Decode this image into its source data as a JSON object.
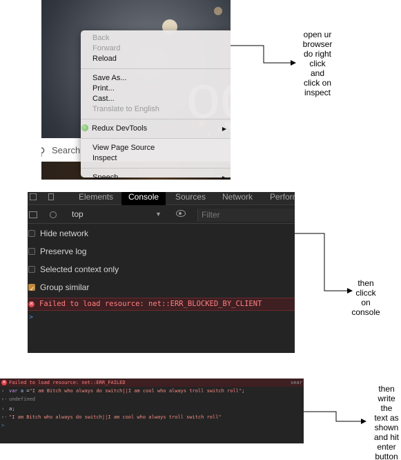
{
  "panel1": {
    "bg_text": "og",
    "search_label": "Search",
    "context_menu": {
      "groups": [
        [
          {
            "label": "Back",
            "disabled": true
          },
          {
            "label": "Forward",
            "disabled": true
          },
          {
            "label": "Reload",
            "disabled": false
          }
        ],
        [
          {
            "label": "Save As...",
            "disabled": false
          },
          {
            "label": "Print...",
            "disabled": false
          },
          {
            "label": "Cast...",
            "disabled": false
          },
          {
            "label": "Translate to English",
            "disabled": true
          }
        ],
        [
          {
            "label": "Redux DevTools",
            "disabled": false,
            "submenu": true
          }
        ],
        [
          {
            "label": "View Page Source",
            "disabled": false
          },
          {
            "label": "Inspect",
            "disabled": false
          }
        ],
        [
          {
            "label": "Speech",
            "disabled": false,
            "submenu": true
          }
        ]
      ]
    }
  },
  "panel2": {
    "tabs": [
      "Elements",
      "Console",
      "Sources",
      "Network",
      "Perform"
    ],
    "active_tab": "Console",
    "context": "top",
    "filter_placeholder": "Filter",
    "options": [
      {
        "label": "Hide network",
        "checked": false
      },
      {
        "label": "Preserve log",
        "checked": false
      },
      {
        "label": "Selected context only",
        "checked": false
      },
      {
        "label": "Group similar",
        "checked": true
      }
    ],
    "error_message": "Failed to load resource: net::ERR_BLOCKED_BY_CLIENT",
    "prompt": ">"
  },
  "panel3": {
    "error_line": "Failed to load resource: net::ERR_FAILED",
    "search_tag": "sear",
    "input1_keyword": "var",
    "input1_var": "a",
    "input1_rest": " =",
    "input1_string": "\"I am Bitch who always do switch||I am cool who always troll switch roll\"",
    "input1_end": ";",
    "output1": "undefined",
    "input2": "a;",
    "output2": "\"I am Bitch who always do switch||I am cool who always troll switch roll\"",
    "prompt": ">"
  },
  "annotations": {
    "step1": "open ur\nbrowser\ndo right\nclick\nand\nclick on\ninspect",
    "step2": "then\nclicck\non\nconsole",
    "step3": "then\nwrite\nthe\ntext as\nshown\nand hit\nenter\nbutton"
  }
}
